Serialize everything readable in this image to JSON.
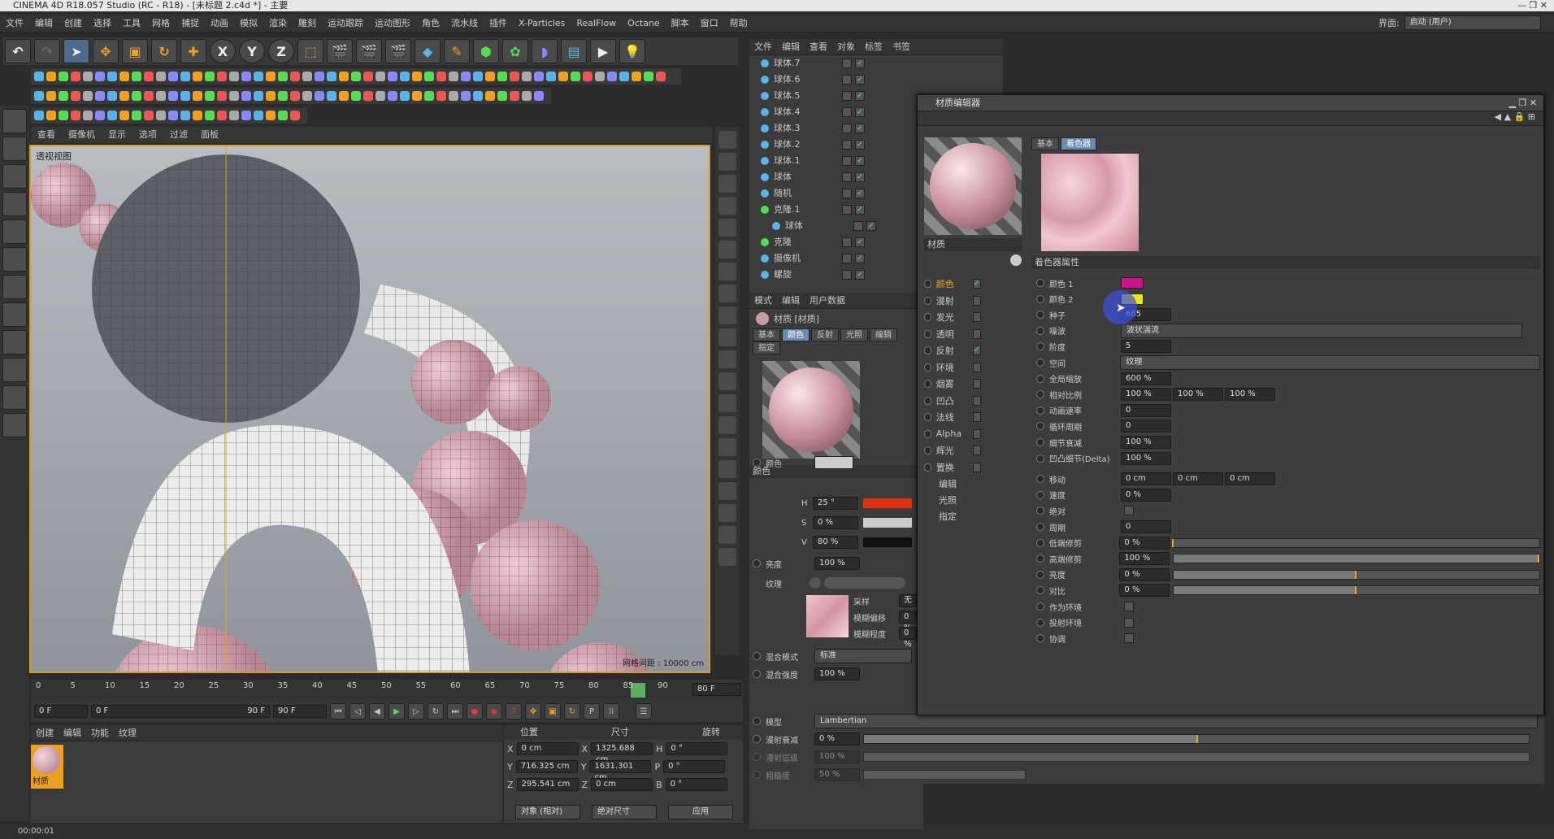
{
  "window": {
    "title": "CINEMA 4D R18.057 Studio (RC - R18) - [未标题 2.c4d *] - 主要"
  },
  "menu": [
    "文件",
    "编辑",
    "创建",
    "选择",
    "工具",
    "网格",
    "捕捉",
    "动画",
    "模拟",
    "渲染",
    "雕刻",
    "运动跟踪",
    "运动图形",
    "角色",
    "流水线",
    "插件",
    "X-Particles",
    "RealFlow",
    "Octane",
    "脚本",
    "窗口",
    "帮助"
  ],
  "interface": {
    "label": "界面:",
    "value": "启动 (用户)"
  },
  "axis_buttons": [
    "X",
    "Y",
    "Z"
  ],
  "viewport": {
    "menu": [
      "查看",
      "摄像机",
      "显示",
      "选项",
      "过滤",
      "面板"
    ],
    "label": "透视视图",
    "grid_info": "网格间距 : 10000 cm"
  },
  "object_manager": {
    "menu": [
      "文件",
      "编辑",
      "查看",
      "对象",
      "标签",
      "书签"
    ],
    "items": [
      "球体.7",
      "球体.6",
      "球体.5",
      "球体.4",
      "球体.3",
      "球体.2",
      "球体.1",
      "球体",
      "随机",
      "克隆.1",
      "球体",
      "克隆",
      "摄像机",
      "螺旋"
    ]
  },
  "attr_manager": {
    "menu": [
      "模式",
      "编辑",
      "用户数据"
    ],
    "title": "材质 [材质]",
    "tabs": [
      "基本",
      "颜色",
      "反射",
      "光照",
      "编辑",
      "指定"
    ],
    "section": "颜色",
    "color_label": "颜色",
    "h": "25 °",
    "s": "0 %",
    "v": "80 %",
    "brightness_label": "亮度",
    "brightness": "100 %",
    "texture_label": "纹理",
    "sampling_label": "采样",
    "sampling": "无",
    "blur_offset_label": "模糊偏移",
    "blur_offset": "0 %",
    "blur_scale_label": "模糊程度",
    "blur_scale": "0 %",
    "mix_mode_label": "混合模式",
    "mix_mode": "标准",
    "mix_strength_label": "混合强度",
    "mix_strength": "100 %",
    "model_label": "模型",
    "model": "Lambertian",
    "diffuse_falloff_label": "漫射衰减",
    "diffuse_falloff": "0 %",
    "diffuse_level_label": "漫射层级",
    "diffuse_level": "100 %",
    "roughness_label": "粗糙度",
    "roughness": "50 %"
  },
  "timeline": {
    "ticks": [
      "0",
      "5",
      "10",
      "15",
      "20",
      "25",
      "30",
      "35",
      "40",
      "45",
      "50",
      "55",
      "60",
      "65",
      "70",
      "75",
      "80",
      "85",
      "90"
    ],
    "current": "80",
    "end_field": "80 F",
    "start": "0 F",
    "range_start": "0 F",
    "range_end": "90 F",
    "max": "90 F"
  },
  "material_manager": {
    "menu": [
      "创建",
      "编辑",
      "功能",
      "纹理"
    ],
    "material_name": "材质"
  },
  "coordinates": {
    "headers": [
      "位置",
      "尺寸",
      "旋转"
    ],
    "rows": [
      {
        "axis": "X",
        "pos": "0 cm",
        "size_axis": "X",
        "size": "1325.688 cm",
        "rot_axis": "H",
        "rot": "0 °"
      },
      {
        "axis": "Y",
        "pos": "716.325 cm",
        "size_axis": "Y",
        "size": "1631.301 cm",
        "rot_axis": "P",
        "rot": "0 °"
      },
      {
        "axis": "Z",
        "pos": "295.541 cm",
        "size_axis": "Z",
        "size": "0 cm",
        "rot_axis": "B",
        "rot": "0 °"
      }
    ],
    "mode": "对象 (相对)",
    "size_mode": "绝对尺寸",
    "apply": "应用"
  },
  "status": {
    "time": "00:00:01"
  },
  "material_editor": {
    "title": "材质编辑器",
    "mat_label": "材质",
    "channels": [
      {
        "name": "颜色",
        "checked": true
      },
      {
        "name": "漫射",
        "checked": false
      },
      {
        "name": "发光",
        "checked": false
      },
      {
        "name": "透明",
        "checked": false
      },
      {
        "name": "反射",
        "checked": true
      },
      {
        "name": "环境",
        "checked": false
      },
      {
        "name": "烟雾",
        "checked": false
      },
      {
        "name": "凹凸",
        "checked": false
      },
      {
        "name": "法线",
        "checked": false
      },
      {
        "name": "Alpha",
        "checked": false
      },
      {
        "name": "辉光",
        "checked": false
      },
      {
        "name": "置换",
        "checked": false
      }
    ],
    "extra": [
      "编辑",
      "光照",
      "指定"
    ],
    "tabs": [
      "基本",
      "着色器"
    ],
    "section": "着色器属性",
    "props": [
      {
        "label": "颜色 1",
        "type": "color",
        "color": "#c8168a"
      },
      {
        "label": "颜色 2",
        "type": "color",
        "color": "#f2e600"
      },
      {
        "label": "种子",
        "value": "665"
      },
      {
        "label": "噪波",
        "value": "波状湍流",
        "type": "dropdown"
      },
      {
        "label": "阶度",
        "value": "5"
      },
      {
        "label": "空间",
        "value": "纹理",
        "type": "dropdown"
      },
      {
        "label": "全局缩放",
        "value": "600 %"
      },
      {
        "label": "相对比例",
        "value": "100 %",
        "v2": "100 %",
        "v3": "100 %"
      },
      {
        "label": "动画速率",
        "value": "0"
      },
      {
        "label": "循环周期",
        "value": "0"
      },
      {
        "label": "细节衰减",
        "value": "100 %"
      },
      {
        "label": "凹凸细节(Delta)",
        "value": "100 %"
      },
      {
        "label": "移动",
        "value": "0 cm",
        "v2": "0 cm",
        "v3": "0 cm"
      },
      {
        "label": "速度",
        "value": "0 %"
      },
      {
        "label": "绝对",
        "type": "check"
      },
      {
        "label": "周期",
        "value": "0"
      },
      {
        "label": "低端修剪",
        "value": "0 %",
        "slider": 0
      },
      {
        "label": "高端修剪",
        "value": "100 %",
        "slider": 1
      },
      {
        "label": "亮度",
        "value": "0 %",
        "slider": 0.5
      },
      {
        "label": "对比",
        "value": "0 %",
        "slider": 0.5
      },
      {
        "label": "作为环境",
        "type": "check"
      },
      {
        "label": "投射环境",
        "type": "check"
      },
      {
        "label": "协调",
        "type": "check"
      }
    ]
  }
}
